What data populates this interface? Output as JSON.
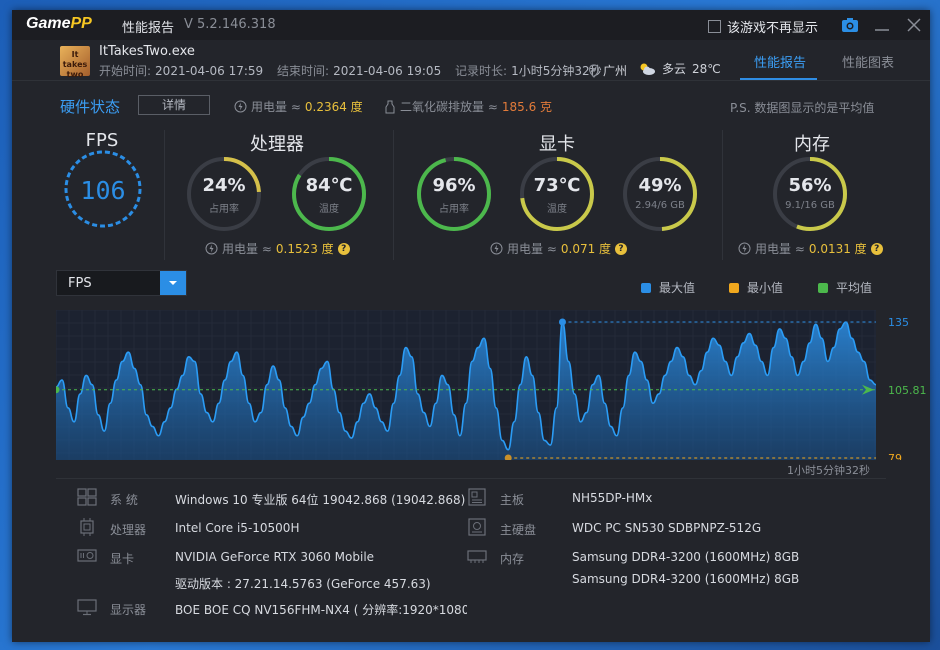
{
  "titlebar": {
    "logo_game": "Game",
    "logo_pp": "PP",
    "title": "性能报告",
    "version": "V 5.2.146.318",
    "no_show_label": "该游戏不再显示"
  },
  "header": {
    "game_name": "ItTakesTwo.exe",
    "start_label": "开始时间:",
    "start_value": "2021-04-06 17:59",
    "end_label": "结束时间:",
    "end_value": "2021-04-06 19:05",
    "duration_label": "记录时长:",
    "duration_value": "1小时5分钟32秒",
    "location": "广州",
    "weather": "多云",
    "temperature": "28℃",
    "tabs": [
      "性能报告",
      "性能图表"
    ]
  },
  "hardware": {
    "title": "硬件状态",
    "detail_button": "详情",
    "power_label": "用电量 ≈",
    "power_value": "0.2364 度",
    "co2_label": "二氧化碳排放量 ≈",
    "co2_value": "185.6 克",
    "note": "P.S. 数据图显示的是平均值"
  },
  "fps": {
    "title": "FPS",
    "value": "106"
  },
  "cpu": {
    "title": "处理器",
    "usage": "24%",
    "usage_label": "占用率",
    "usage_fraction": 0.24,
    "temp": "84℃",
    "temp_label": "温度",
    "temp_fraction": 0.84,
    "power_label": "用电量 ≈",
    "power_value": "0.1523 度"
  },
  "gpu": {
    "title": "显卡",
    "usage": "96%",
    "usage_label": "占用率",
    "usage_fraction": 0.96,
    "temp": "73℃",
    "temp_label": "温度",
    "temp_fraction": 0.73,
    "vram": "49%",
    "vram_label": "2.94/6 GB",
    "vram_fraction": 0.49,
    "power_label": "用电量 ≈",
    "power_value": "0.071 度"
  },
  "memory": {
    "title": "内存",
    "usage": "56%",
    "usage_label": "9.1/16 GB",
    "usage_fraction": 0.56,
    "power_label": "用电量 ≈",
    "power_value": "0.0131 度"
  },
  "chart_controls": {
    "selected": "FPS",
    "legend": [
      "最大值",
      "最小值",
      "平均值"
    ],
    "legend_colors": [
      "#2b8ee5",
      "#f0a81e",
      "#4cb84c"
    ]
  },
  "chart_data": {
    "type": "area",
    "series": [
      {
        "name": "FPS",
        "values": [
          107,
          110,
          98,
          92,
          104,
          112,
          108,
          95,
          88,
          100,
          110,
          118,
          122,
          115,
          108,
          95,
          90,
          86,
          92,
          98,
          106,
          112,
          120,
          118,
          104,
          96,
          92,
          100,
          110,
          118,
          122,
          112,
          100,
          92,
          96,
          108,
          116,
          110,
          98,
          90,
          86,
          94,
          100,
          108,
          115,
          118,
          106,
          96,
          88,
          85,
          92,
          100,
          104,
          98,
          92,
          88,
          100,
          112,
          124,
          120,
          104,
          96,
          90,
          100,
          112,
          108,
          95,
          86,
          100,
          118,
          124,
          128,
          115,
          98,
          84,
          80,
          92,
          108,
          120,
          112,
          96,
          84,
          82,
          98,
          135,
          118,
          104,
          92,
          96,
          108,
          112,
          100,
          90,
          86,
          98,
          112,
          122,
          118,
          110,
          100,
          104,
          112,
          118,
          124,
          120,
          112,
          108,
          114,
          122,
          128,
          125,
          118,
          112,
          120,
          126,
          130,
          125,
          118,
          112,
          124,
          132,
          128,
          120,
          112,
          118,
          126,
          134,
          128,
          118,
          124,
          132,
          135,
          128,
          122,
          118,
          110,
          108
        ]
      }
    ],
    "max": 135,
    "min": 79,
    "avg": 105.81,
    "ylim": [
      79,
      135
    ],
    "x_end_label": "1小时5分钟32秒"
  },
  "system": {
    "os_label": "系 统",
    "os_value": "Windows 10 专业版 64位  19042.868 (19042.868)",
    "cpu_label": "处理器",
    "cpu_value": "Intel Core i5-10500H",
    "gpu_label": "显卡",
    "gpu_value": "NVIDIA GeForce RTX 3060 Mobile",
    "driver_value": "驱动版本 : 27.21.14.5763 (GeForce 457.63)",
    "monitor_label": "显示器",
    "monitor_value": "BOE BOE CQ NV156FHM-NX4 ( 分辨率:1920*1080",
    "board_label": "主板",
    "board_value": "NH55DP-HMx",
    "disk_label": "主硬盘",
    "disk_value": "WDC PC SN530 SDBPNPZ-512G",
    "mem_label": "内存",
    "mem_value_1": "Samsung DDR4-3200 (1600MHz) 8GB",
    "mem_value_2": "Samsung DDR4-3200 (1600MHz) 8GB"
  }
}
